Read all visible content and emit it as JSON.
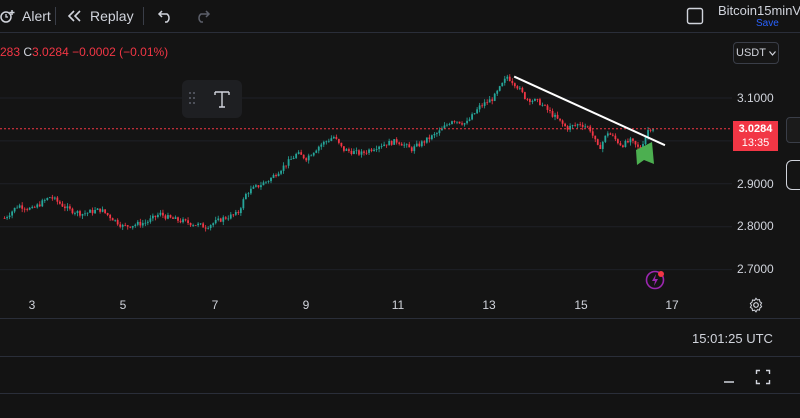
{
  "toolbar": {
    "alert_label": "Alert",
    "replay_label": "Replay",
    "layout_name": "Bitcoin15minV",
    "save_label": "Save"
  },
  "legend": {
    "high_fragment": "283",
    "close_prefix": "C",
    "close_value": "3.0284",
    "change": "−0.0002",
    "change_pct": "(−0.01%)"
  },
  "currency_selector": {
    "label": "USDT"
  },
  "current_price": {
    "value": "3.0284",
    "countdown": "13:35",
    "color": "#f23645"
  },
  "chart_data": {
    "type": "candlestick",
    "y_axis": {
      "ticks": [
        "3.1000",
        "2.9000",
        "2.8000",
        "2.7000"
      ],
      "range": [
        2.66,
        3.2
      ]
    },
    "x_axis": {
      "ticks": [
        "3",
        "5",
        "7",
        "9",
        "11",
        "13",
        "15",
        "17"
      ]
    },
    "path_points": [
      [
        2.4,
        2.82
      ],
      [
        2.7,
        2.85
      ],
      [
        3.0,
        2.84
      ],
      [
        3.4,
        2.87
      ],
      [
        3.8,
        2.84
      ],
      [
        4.1,
        2.83
      ],
      [
        4.5,
        2.84
      ],
      [
        5.0,
        2.8
      ],
      [
        5.5,
        2.81
      ],
      [
        5.8,
        2.83
      ],
      [
        6.0,
        2.82
      ],
      [
        6.4,
        2.81
      ],
      [
        6.8,
        2.8
      ],
      [
        7.2,
        2.82
      ],
      [
        7.5,
        2.83
      ],
      [
        7.7,
        2.88
      ],
      [
        8.2,
        2.91
      ],
      [
        8.5,
        2.94
      ],
      [
        8.8,
        2.97
      ],
      [
        9.0,
        2.96
      ],
      [
        9.3,
        2.99
      ],
      [
        9.6,
        3.01
      ],
      [
        9.8,
        2.98
      ],
      [
        10.2,
        2.97
      ],
      [
        10.6,
        2.99
      ],
      [
        11.0,
        3.0
      ],
      [
        11.3,
        2.98
      ],
      [
        11.6,
        3.0
      ],
      [
        11.9,
        3.02
      ],
      [
        12.2,
        3.05
      ],
      [
        12.5,
        3.04
      ],
      [
        12.8,
        3.08
      ],
      [
        13.1,
        3.1
      ],
      [
        13.4,
        3.15
      ],
      [
        13.6,
        3.13
      ],
      [
        13.8,
        3.1
      ],
      [
        14.1,
        3.09
      ],
      [
        14.4,
        3.06
      ],
      [
        14.7,
        3.03
      ],
      [
        15.0,
        3.04
      ],
      [
        15.2,
        3.03
      ],
      [
        15.4,
        2.98
      ],
      [
        15.6,
        3.02
      ],
      [
        15.9,
        2.99
      ],
      [
        16.1,
        3.0
      ],
      [
        16.3,
        2.98
      ],
      [
        16.5,
        3.03
      ],
      [
        16.6,
        3.03
      ]
    ],
    "trendline": {
      "start": [
        13.55,
        3.15
      ],
      "end": [
        16.85,
        2.99
      ],
      "color": "#ffffff"
    },
    "current_price_line": {
      "value": 3.0284,
      "color": "#f23645"
    },
    "up_color": "#26a69a",
    "down_color": "#f23645",
    "grid": true
  },
  "status": {
    "time": "15:01:25 UTC"
  },
  "icons": {
    "undo": "undo-icon",
    "redo": "redo-icon",
    "text_tool": "text-tool-icon",
    "settings": "gear-icon",
    "flash": "lightning-icon"
  }
}
